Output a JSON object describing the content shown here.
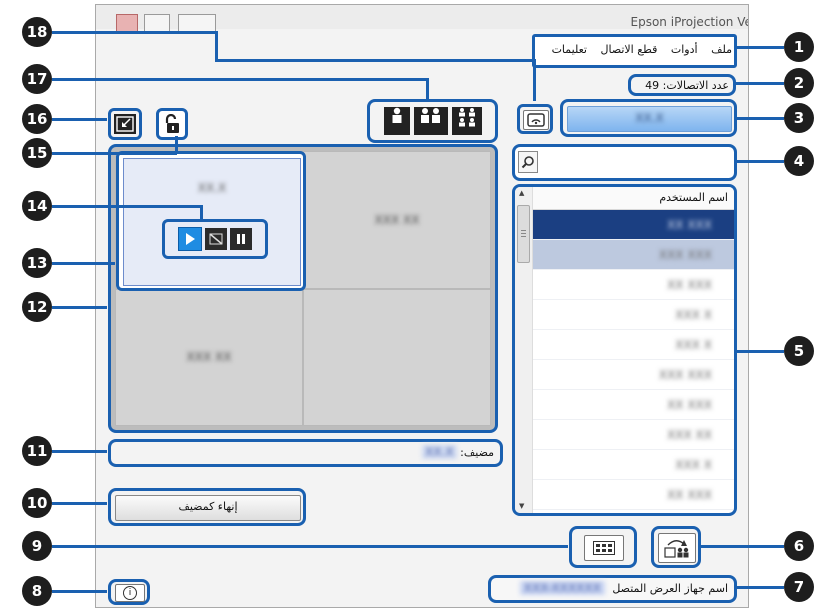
{
  "window": {
    "title": "Epson iProjection Ver.X.XX"
  },
  "menu": {
    "file": "ملف",
    "tools": "أدوات",
    "disconnect": "قطع الاتصال",
    "help": "تعليمات"
  },
  "connections": {
    "label": "عدد الاتصالات:",
    "count": "49"
  },
  "own_user": "XX.X",
  "search": {
    "placeholder": ""
  },
  "user_list": {
    "header": "اسم المستخدم",
    "rows": [
      "XX XXX",
      "XXX XXX",
      "XX XXX",
      "XXX X",
      "XXX X",
      "XXX XXX",
      "XX XXX",
      "XXX XX",
      "XXX X",
      "XX XXX"
    ]
  },
  "panels": {
    "panel_1": "XX.X",
    "panel_2": "XXX XX",
    "panel_3": "XXX XX"
  },
  "presenter": {
    "label": "مضيف:",
    "value": "XX.X"
  },
  "end_moderator_button": "إنهاء كمضيف",
  "connected_device": {
    "label": "اسم جهاز العرض المتصل",
    "value": "XXX-XXXXXX"
  },
  "callouts": [
    "1",
    "2",
    "3",
    "4",
    "5",
    "6",
    "7",
    "8",
    "9",
    "10",
    "11",
    "12",
    "13",
    "14",
    "15",
    "16",
    "17",
    "18"
  ],
  "colors": {
    "accent": "#1a60b0",
    "selected": "#1b3f82",
    "callout": "#1e1e1e"
  }
}
